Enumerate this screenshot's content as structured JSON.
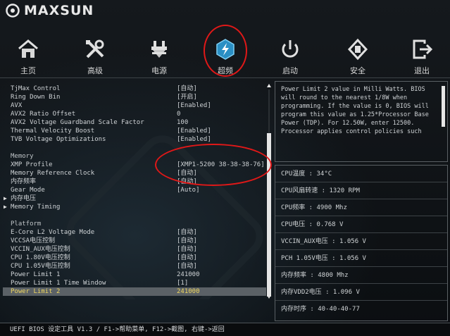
{
  "brand": {
    "name": "MAXSUN"
  },
  "nav": {
    "items": [
      {
        "label": "主页",
        "icon": "home-icon"
      },
      {
        "label": "高级",
        "icon": "tools-icon"
      },
      {
        "label": "电源",
        "icon": "power-icon"
      },
      {
        "label": "超频",
        "icon": "overclock-icon"
      },
      {
        "label": "启动",
        "icon": "boot-icon"
      },
      {
        "label": "安全",
        "icon": "security-icon"
      },
      {
        "label": "退出",
        "icon": "exit-icon"
      }
    ],
    "active": "超频"
  },
  "settings": {
    "rows": [
      {
        "label": "TjMax Control",
        "value": "[自动]"
      },
      {
        "label": "Ring Down Bin",
        "value": "[开启]"
      },
      {
        "label": "AVX",
        "value": "[Enabled]"
      },
      {
        "label": "AVX2 Ratio Offset",
        "value": "0"
      },
      {
        "label": "AVX2 Voltage Guardband Scale Factor",
        "value": "100"
      },
      {
        "label": "Thermal Velocity Boost",
        "value": "[Enabled]"
      },
      {
        "label": "TVB Voltage Optimizations",
        "value": "[Enabled]"
      },
      {
        "label": "",
        "value": ""
      },
      {
        "label": "Memory",
        "value": ""
      },
      {
        "label": "XMP Profile",
        "value": "[XMP1-5200 38-38-38-76]"
      },
      {
        "label": "Memory Reference Clock",
        "value": "[自动]"
      },
      {
        "label": "内存频率",
        "value": "[自动]"
      },
      {
        "label": "Gear Mode",
        "value": "[Auto]"
      },
      {
        "label": "内存电压",
        "value": ""
      },
      {
        "label": "Memory Timing",
        "value": ""
      },
      {
        "label": "",
        "value": ""
      },
      {
        "label": "Platform",
        "value": ""
      },
      {
        "label": "E-Core L2 Voltage Mode",
        "value": "[自动]"
      },
      {
        "label": "VCCSA电压控制",
        "value": "[自动]"
      },
      {
        "label": "VCCIN_AUX电压控制",
        "value": "[自动]"
      },
      {
        "label": "CPU 1.80V电压控制",
        "value": "[自动]"
      },
      {
        "label": "CPU 1.05V电压控制",
        "value": "[自动]"
      },
      {
        "label": "Power Limit 1",
        "value": "241000"
      },
      {
        "label": "Power Limit 1 Time Window",
        "value": "[1]"
      },
      {
        "label": "Power Limit 2",
        "value": "241000"
      }
    ]
  },
  "help": {
    "text": "Power Limit 2 value in Milli Watts. BIOS will round to the nearest 1/8W when programming. If the value is 0, BIOS will program this value as 1.25*Processor Base Power (TDP). For 12.50W, enter 12500. Processor applies control policies such"
  },
  "status": {
    "rows": [
      "CPU温度 : 34°C",
      "CPU风扇转速 : 1320 RPM",
      "CPU频率 : 4900 Mhz",
      "CPU电压 : 0.768 V",
      "VCCIN_AUX电压 : 1.056 V",
      "PCH 1.05V电压 : 1.056 V",
      "内存频率 : 4800 Mhz",
      "内存VDD2电压 : 1.096 V",
      "内存时序 : 40-40-40-77"
    ]
  },
  "footer": {
    "text": "UEFI BIOS 设定工具 V1.3 / F1->帮助菜单, F12->截图, 右键->返回"
  },
  "colors": {
    "accent": "#2fa8e0",
    "annotation": "#e01818",
    "selected_text": "#f0d860"
  }
}
